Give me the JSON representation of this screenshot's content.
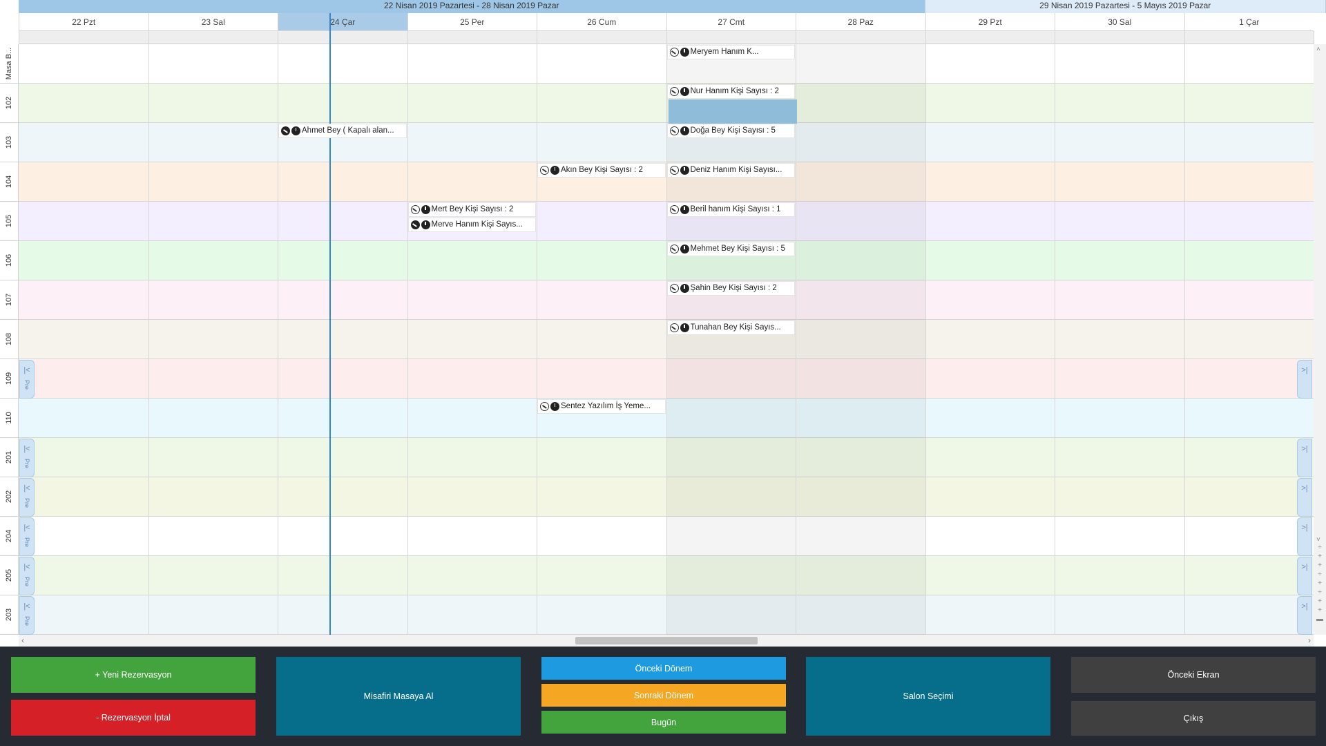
{
  "header": {
    "weeks": [
      {
        "label": "22 Nisan 2019 Pazartesi - 28 Nisan 2019 Pazar",
        "active": true
      },
      {
        "label": "29 Nisan 2019 Pazartesi - 5 Mayıs 2019 Pazar",
        "active": false
      }
    ],
    "days": [
      "22 Pzt",
      "23 Sal",
      "24 Çar",
      "25 Per",
      "26 Cum",
      "27 Cmt",
      "28 Paz",
      "29 Pzt",
      "30 Sal",
      "1 Çar"
    ],
    "today_index": 2
  },
  "resources": [
    {
      "label": "Masa B...",
      "color": "#ffffff"
    },
    {
      "label": "102",
      "color": "#eff7e6"
    },
    {
      "label": "103",
      "color": "#eef6f9"
    },
    {
      "label": "104",
      "color": "#fdf0e3"
    },
    {
      "label": "105",
      "color": "#f3efff"
    },
    {
      "label": "106",
      "color": "#e5fbe7"
    },
    {
      "label": "107",
      "color": "#fdf0f6"
    },
    {
      "label": "108",
      "color": "#f5f3ec"
    },
    {
      "label": "109",
      "color": "#feeded"
    },
    {
      "label": "110",
      "color": "#e8f8fc"
    },
    {
      "label": "201",
      "color": "#eff7e6"
    },
    {
      "label": "202",
      "color": "#f3f6e2"
    },
    {
      "label": "204",
      "color": "#ffffff"
    },
    {
      "label": "205",
      "color": "#eff7e6"
    },
    {
      "label": "203",
      "color": "#eef6f9"
    }
  ],
  "appointments": [
    {
      "text": "Meryem Hanım  K...",
      "row": 0,
      "day": 5,
      "slot": 0,
      "status": "open"
    },
    {
      "text": "Nur Hanım  Kişi Sayısı : 2",
      "row": 1,
      "day": 5,
      "slot": 0,
      "status": "open"
    },
    {
      "text": "Ahmet Bey ( Kapalı alan...",
      "row": 2,
      "day": 2,
      "slot": 0,
      "status": "minus"
    },
    {
      "text": "Doğa Bey  Kişi Sayısı : 5",
      "row": 2,
      "day": 5,
      "slot": 0,
      "status": "open"
    },
    {
      "text": "Akın Bey  Kişi Sayısı : 2",
      "row": 3,
      "day": 4,
      "slot": 0,
      "status": "open"
    },
    {
      "text": "Deniz Hanım  Kişi Sayısı...",
      "row": 3,
      "day": 5,
      "slot": 0,
      "status": "open"
    },
    {
      "text": "Mert Bey  Kişi Sayısı : 2",
      "row": 4,
      "day": 3,
      "slot": 0,
      "status": "open"
    },
    {
      "text": "Merve Hanım  Kişi Sayıs...",
      "row": 4,
      "day": 3,
      "slot": 1,
      "status": "filled"
    },
    {
      "text": "Beril hanım  Kişi Sayısı : 1",
      "row": 4,
      "day": 5,
      "slot": 0,
      "status": "open"
    },
    {
      "text": "Mehmet Bey  Kişi Sayısı : 5",
      "row": 5,
      "day": 5,
      "slot": 0,
      "status": "open"
    },
    {
      "text": "Şahin Bey  Kişi Sayısı : 2",
      "row": 6,
      "day": 5,
      "slot": 0,
      "status": "open"
    },
    {
      "text": "Tunahan Bey  Kişi Sayıs...",
      "row": 7,
      "day": 5,
      "slot": 0,
      "status": "open"
    },
    {
      "text": "Sentez Yazılım İş Yeme...",
      "row": 9,
      "day": 4,
      "slot": 0,
      "status": "open"
    }
  ],
  "nav_rows": [
    8,
    10,
    11,
    12,
    13,
    14
  ],
  "nav_prev_label": "Pre",
  "toolbar": {
    "new_reservation": "+ Yeni Rezervasyon",
    "cancel_reservation": "- Rezervasyon İptal",
    "seat_guest": "Misafiri Masaya Al",
    "previous_period": "Önceki Dönem",
    "next_period": "Sonraki Dönem",
    "today": "Bugün",
    "salon_selection": "Salon Seçimi",
    "previous_screen": "Önceki Ekran",
    "exit": "Çıkış"
  },
  "colors": {
    "green": "#43a33d",
    "red": "#d42026",
    "teal": "#066e8a",
    "blue": "#1e9be0",
    "orange": "#f5a623",
    "gray": "#404040",
    "toolbar_bg": "#262a33"
  }
}
